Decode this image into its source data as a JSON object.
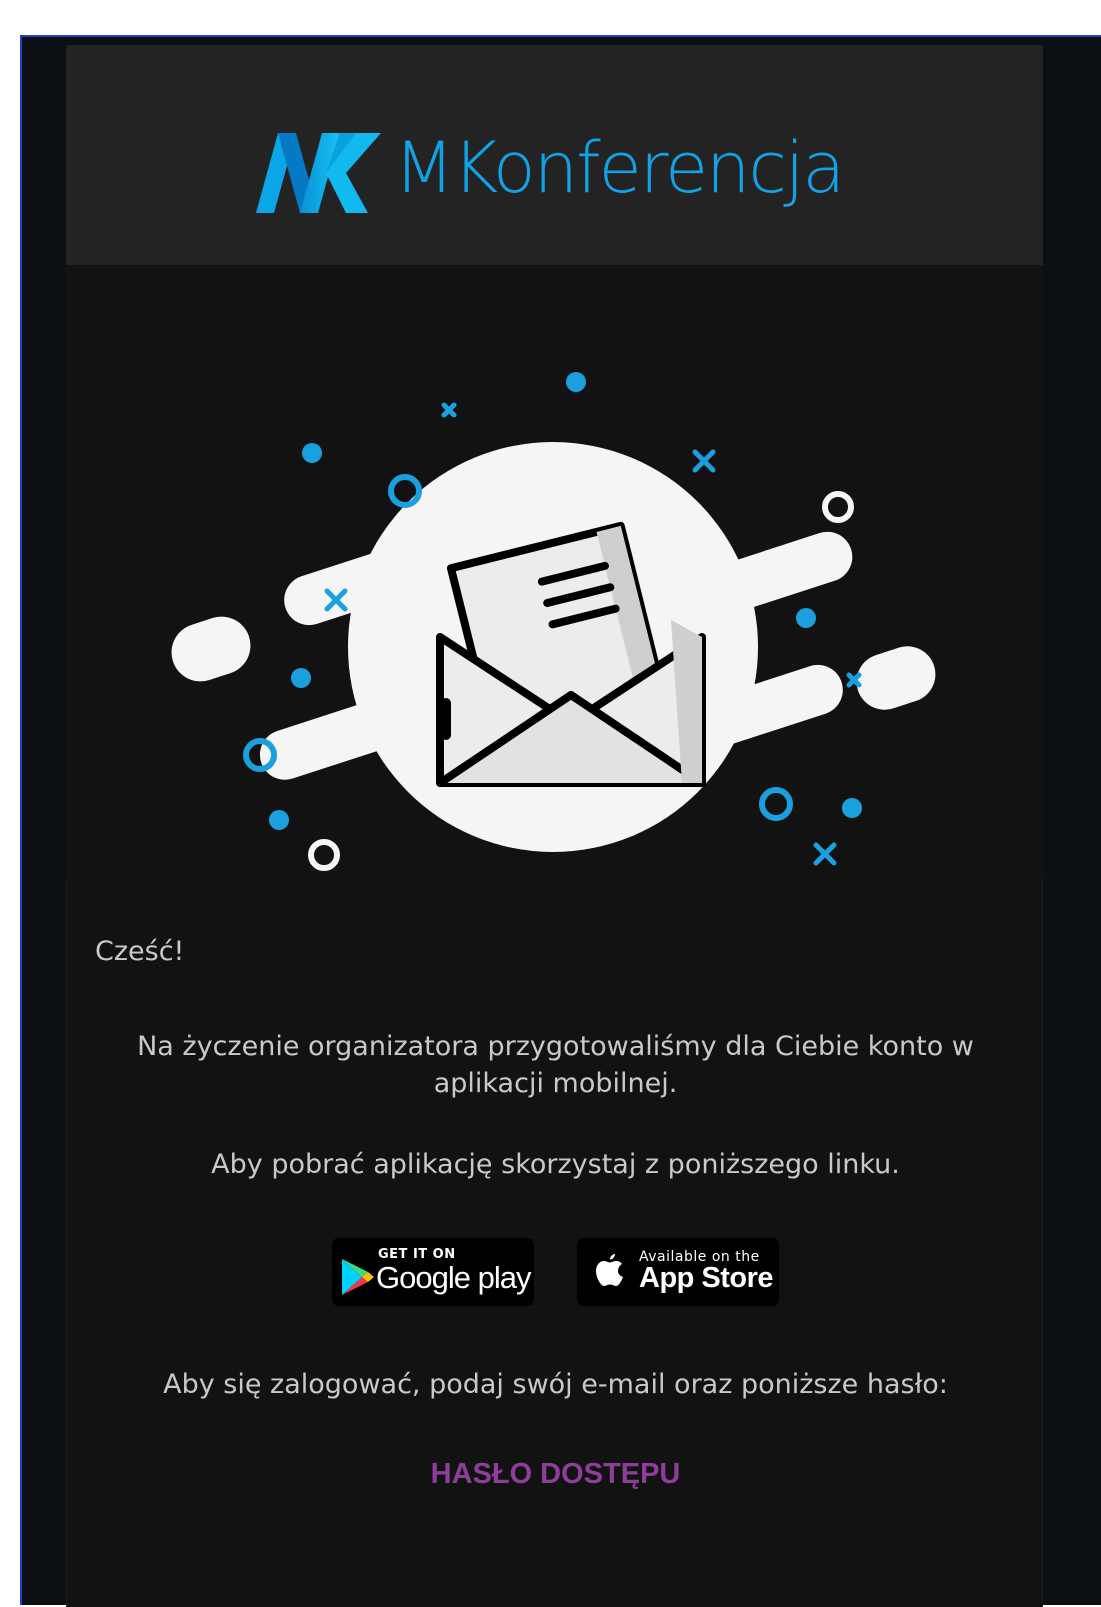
{
  "brand": {
    "name": "MKonferencja",
    "color": "#12a3e6"
  },
  "message": {
    "greeting": "Cześć!",
    "account_text": "Na życzenie organizatora przygotowaliśmy dla Ciebie konto w aplikacji mobilnej.",
    "download_text": "Aby pobrać aplikację skorzystaj z poniższego linku.",
    "login_text": "Aby się zalogować, podaj swój e-mail oraz poniższe hasło:",
    "password_label": "HASŁO DOSTĘPU",
    "password_color": "#8e3e9a"
  },
  "stores": {
    "google": {
      "small": "GET IT ON",
      "big": "Google play"
    },
    "apple": {
      "small": "Available on the",
      "big": "App Store"
    }
  },
  "illustration": {
    "icon": "open-envelope-icon",
    "accent": "#1aa0de"
  }
}
